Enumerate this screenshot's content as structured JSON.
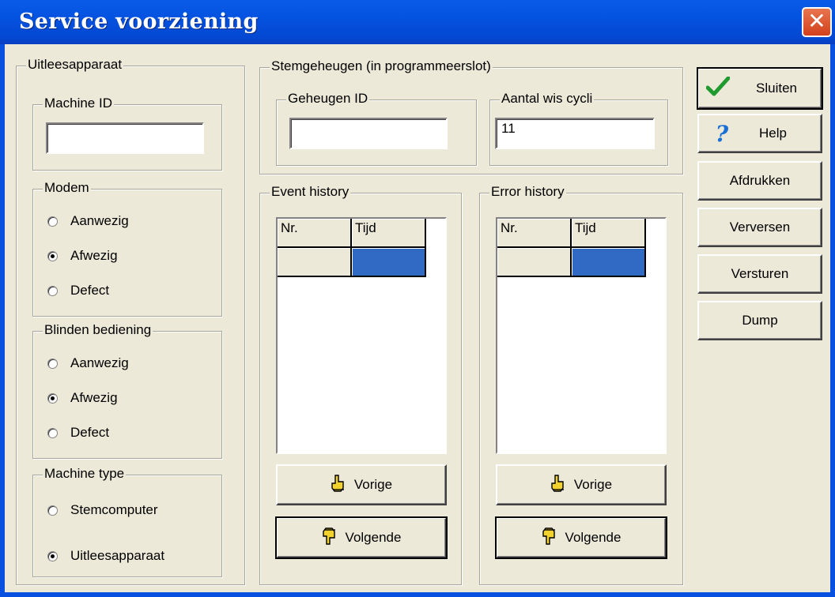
{
  "window": {
    "title": "Service voorziening",
    "close_glyph": "✕"
  },
  "uitlees": {
    "legend": "Uitleesapparaat",
    "machine_id": {
      "legend": "Machine ID",
      "value": ""
    },
    "modem": {
      "legend": "Modem",
      "options": [
        "Aanwezig",
        "Afwezig",
        "Defect"
      ],
      "selected": "Afwezig"
    },
    "blinden": {
      "legend": "Blinden bediening",
      "options": [
        "Aanwezig",
        "Afwezig",
        "Defect"
      ],
      "selected": "Afwezig"
    },
    "machine_type": {
      "legend": "Machine type",
      "options": [
        "Stemcomputer",
        "Uitleesapparaat"
      ],
      "selected": "Uitleesapparaat"
    }
  },
  "stem": {
    "legend": "Stemgeheugen (in programmeerslot)",
    "geheugen_id": {
      "legend": "Geheugen ID",
      "value": ""
    },
    "wis_cycli": {
      "legend": "Aantal wis cycli",
      "value": "11"
    }
  },
  "event_history": {
    "legend": "Event history",
    "columns": [
      "Nr.",
      "Tijd"
    ],
    "prev_label": "Vorige",
    "next_label": "Volgende"
  },
  "error_history": {
    "legend": "Error history",
    "columns": [
      "Nr.",
      "Tijd"
    ],
    "prev_label": "Vorige",
    "next_label": "Volgende"
  },
  "actions": {
    "sluiten": "Sluiten",
    "help": "Help",
    "afdrukken": "Afdrukken",
    "verversen": "Verversen",
    "versturen": "Versturen",
    "dump": "Dump"
  },
  "icons": {
    "check": "check-icon",
    "help": "question-icon",
    "prev": "hand-up-icon",
    "next": "hand-down-icon"
  },
  "colors": {
    "titlebar": "#0452e0",
    "selection": "#316ac5",
    "face": "#ece9d8",
    "close": "#d2411c",
    "check": "#1e9a2e"
  }
}
